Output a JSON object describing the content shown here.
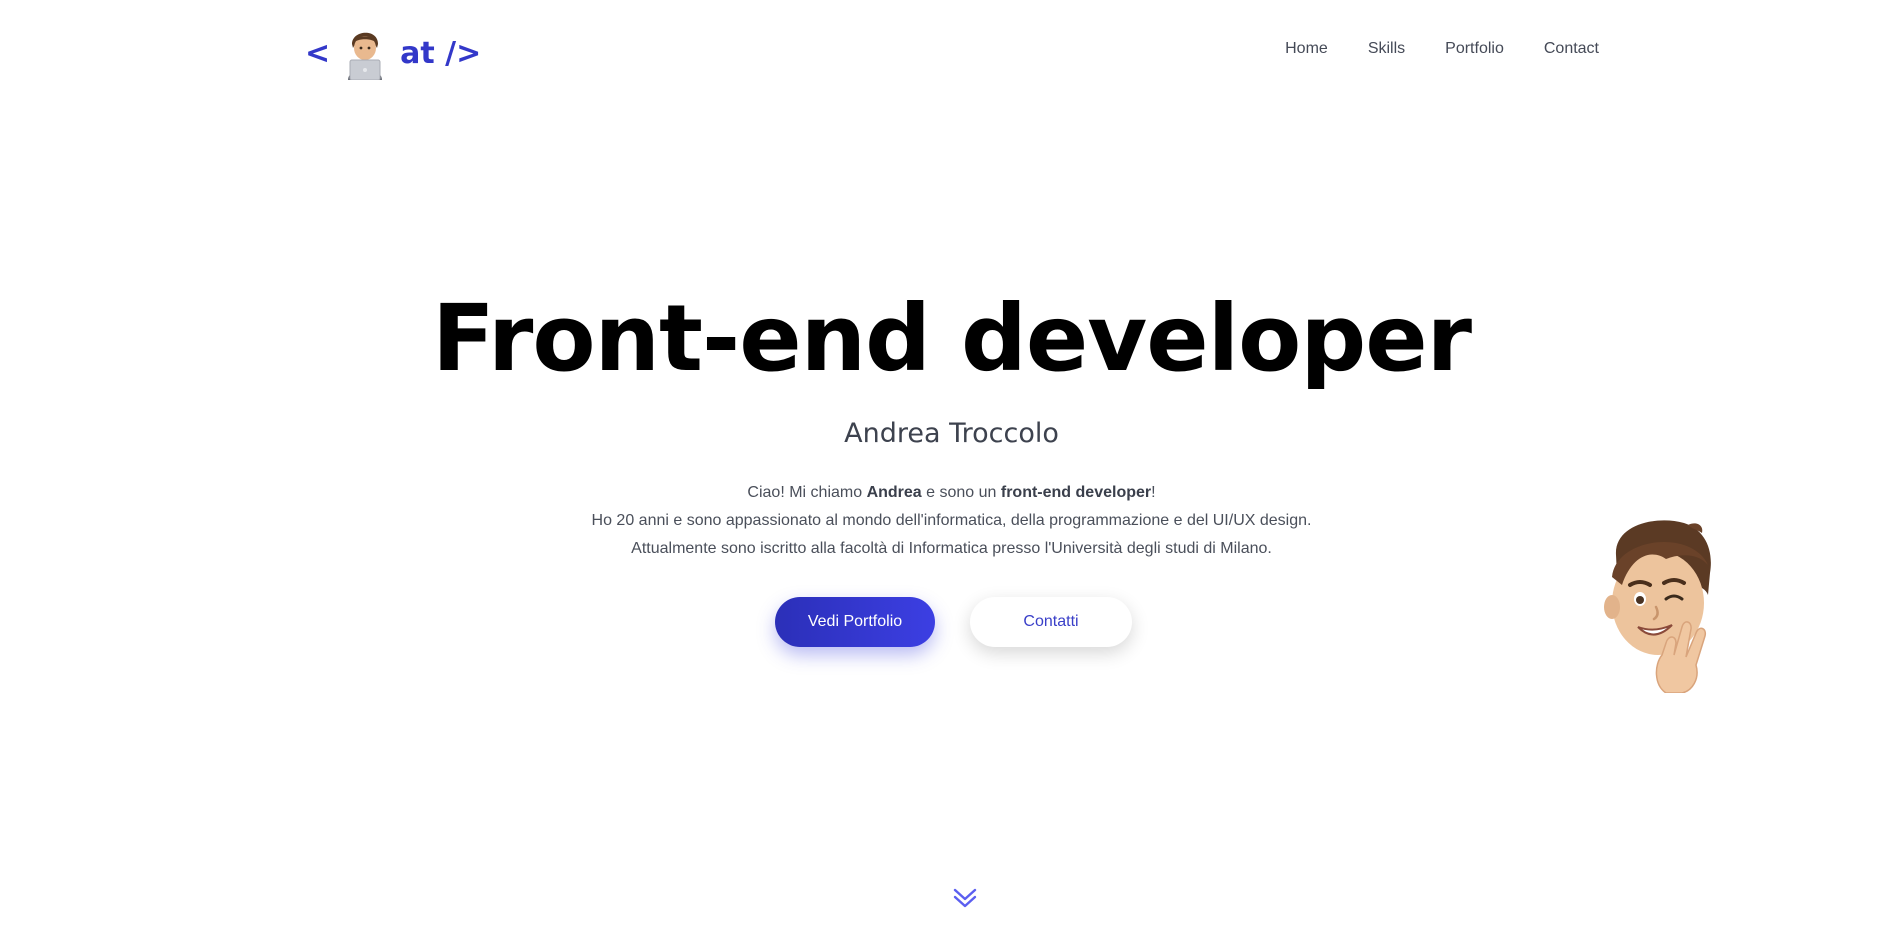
{
  "logo": {
    "open": "<",
    "close": "at />",
    "emoji_icon": "technologist-emoji-icon"
  },
  "nav": {
    "items": [
      {
        "label": "Home"
      },
      {
        "label": "Skills"
      },
      {
        "label": "Portfolio"
      },
      {
        "label": "Contact"
      }
    ]
  },
  "hero": {
    "title": "Front-end developer",
    "name": "Andrea Troccolo",
    "intro": {
      "prefix": "Ciao! Mi chiamo ",
      "name_bold": "Andrea",
      "middle": " e sono un ",
      "role_bold": "front-end developer",
      "suffix": "!"
    },
    "line2": "Ho 20 anni e sono appassionato al mondo dell'informatica, della programmazione e del UI/UX design.",
    "line3": "Attualmente sono iscritto alla facoltà di Informatica presso l'Università degli studi di Milano.",
    "primary_button": "Vedi Portfolio",
    "secondary_button": "Contatti"
  },
  "decor": {
    "memoji": "waving-memoji-icon",
    "scroll": "double-chevron-down-icon"
  },
  "colors": {
    "accent": "#3338c9",
    "accent_light": "#5b5ff0",
    "text": "#3a3f4b",
    "title": "#000000"
  }
}
